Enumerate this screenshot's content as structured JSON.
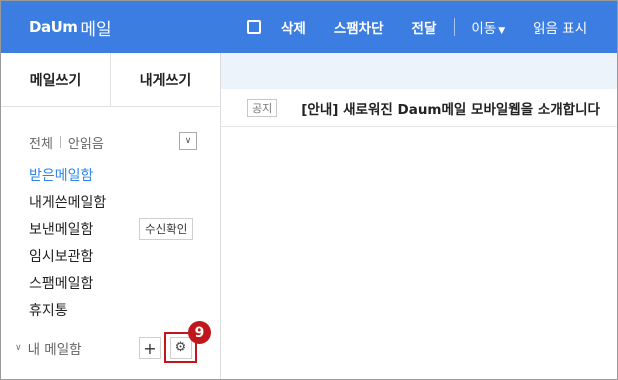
{
  "app": {
    "logo_mark": "DaUm",
    "logo_text": "메일"
  },
  "toolbar": {
    "delete_label": "삭제",
    "spam_block_label": "스팸차단",
    "forward_label": "전달",
    "move_label": "이동",
    "read_display_label": "읽음 표시"
  },
  "sidebar": {
    "write_mail_label": "메일쓰기",
    "write_self_label": "내게쓰기",
    "filter_all_label": "전체",
    "filter_unread_label": "안읽음",
    "folders": [
      {
        "label": "받은메일함"
      },
      {
        "label": "내게쓴메일함"
      },
      {
        "label": "보낸메일함"
      },
      {
        "label": "임시보관함"
      },
      {
        "label": "스팸메일함"
      },
      {
        "label": "휴지통"
      }
    ],
    "read_confirm_label": "수신확인",
    "my_mailbox_label": "내 메일함",
    "add_label": "+",
    "step_badge": "9"
  },
  "mail_list": {
    "rows": [
      {
        "badge": "공지",
        "subject": "[안내] 새로워진 Daum메일 모바일웹을 소개합니다"
      }
    ]
  },
  "colors": {
    "topbar": "#3b7de0",
    "active_folder": "#2f86e8",
    "highlight": "#c0171d"
  }
}
